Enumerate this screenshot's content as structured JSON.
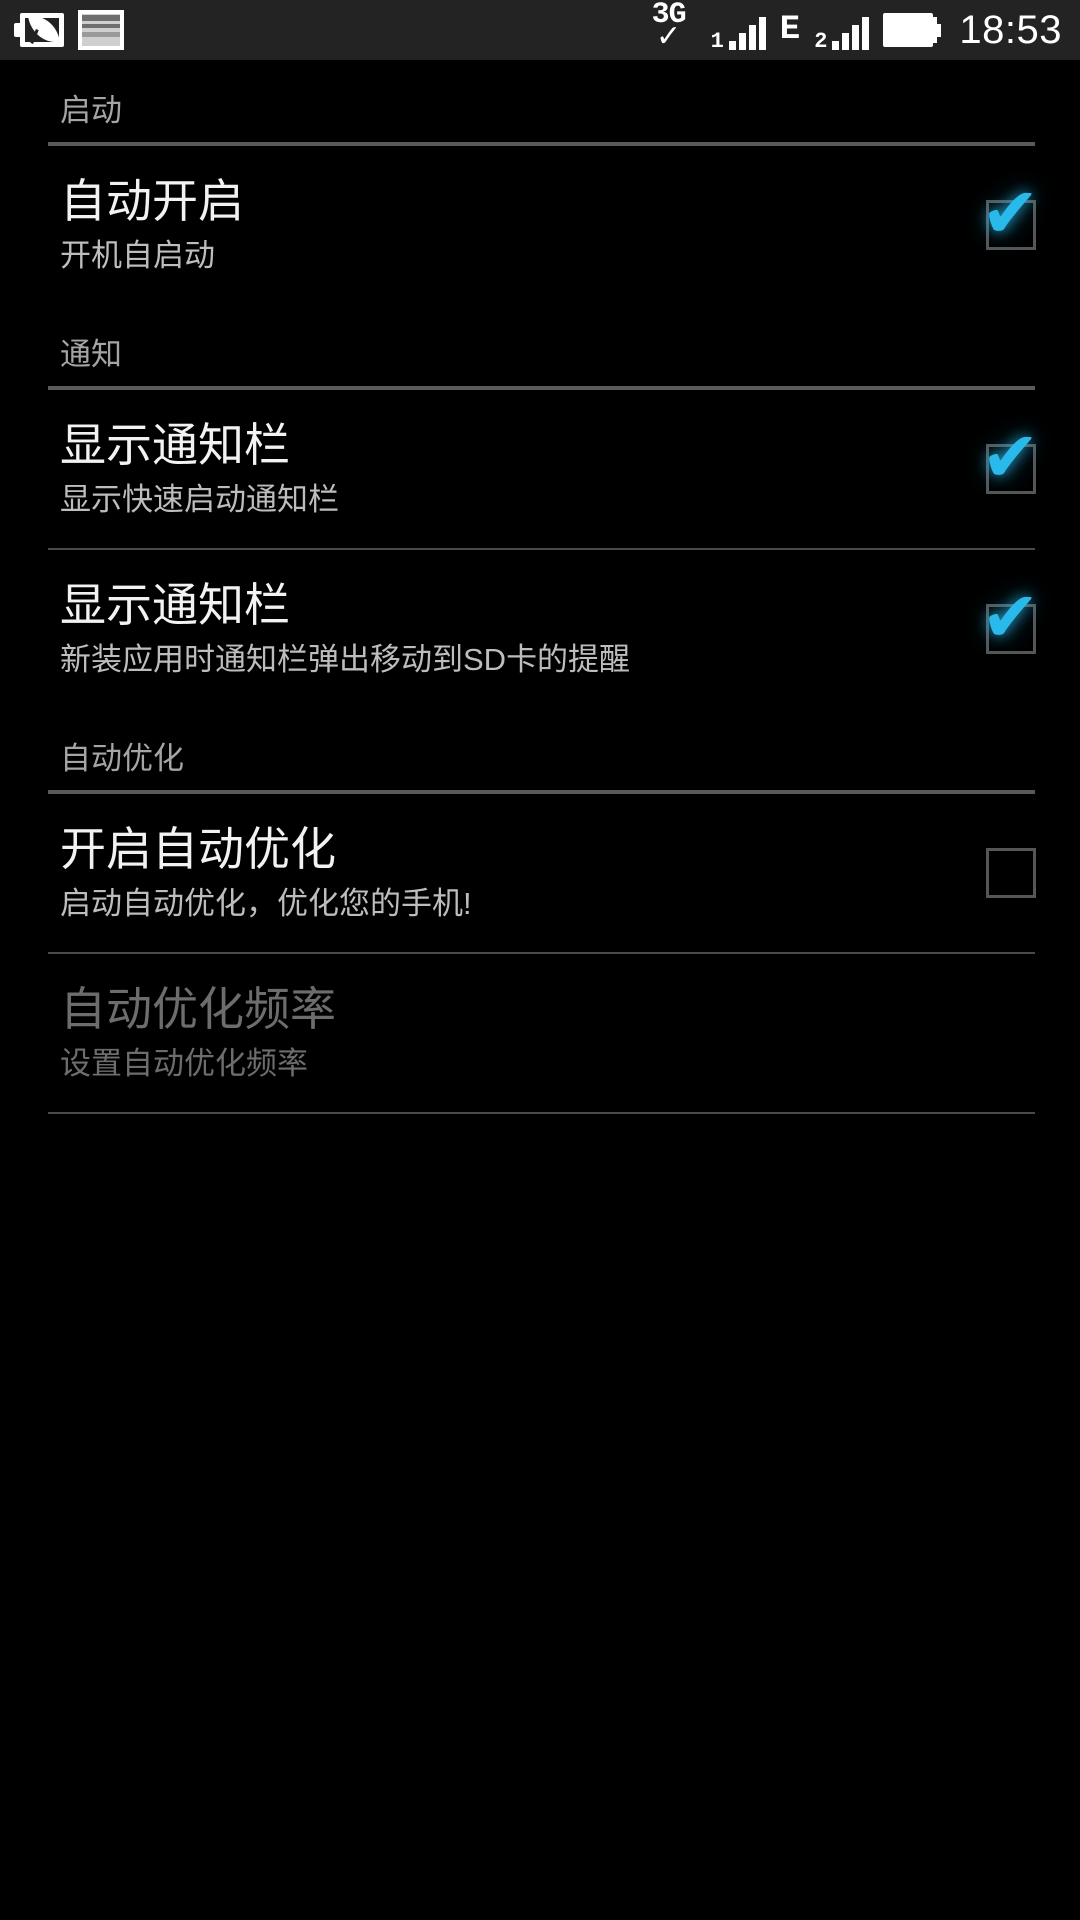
{
  "statusbar": {
    "icons": [
      {
        "name": "power-saver-leaf-battery-icon"
      },
      {
        "name": "screenshot-picture-icon"
      },
      {
        "name": "network-3g-check-icon",
        "label": "3G",
        "check": "✓"
      },
      {
        "name": "signal-bars-sim1-icon",
        "sim": "1"
      },
      {
        "name": "network-edge-icon",
        "label": "E"
      },
      {
        "name": "signal-bars-sim2-icon",
        "sim": "2"
      },
      {
        "name": "battery-full-icon"
      }
    ],
    "network_3g_label": "3G",
    "network_3g_check": "✓",
    "sim1_label": "1",
    "edge_label": "E",
    "sim2_label": "2",
    "clock": "18:53"
  },
  "colors": {
    "background": "#000000",
    "statusbar_bg": "#232323",
    "accent_check": "#29b9ea",
    "section_header_text": "#a5a5a5",
    "title_text": "#f2f2f2",
    "subtitle_text": "#bdbdbd",
    "disabled_text": "#6d6d6d",
    "divider_thick": "#5a5a5a",
    "divider_thin": "#4a4a4a",
    "checkbox_border": "#565656"
  },
  "sections": [
    {
      "header": "启动",
      "items": [
        {
          "title": "自动开启",
          "subtitle": "开机自启动",
          "checked": true,
          "enabled": true,
          "check_glyph": "✔"
        }
      ]
    },
    {
      "header": "通知",
      "items": [
        {
          "title": "显示通知栏",
          "subtitle": "显示快速启动通知栏",
          "checked": true,
          "enabled": true,
          "check_glyph": "✔"
        },
        {
          "title": "显示通知栏",
          "subtitle": "新装应用时通知栏弹出移动到SD卡的提醒",
          "checked": true,
          "enabled": true,
          "check_glyph": "✔"
        }
      ]
    },
    {
      "header": "自动优化",
      "items": [
        {
          "title": "开启自动优化",
          "subtitle": "启动自动优化，优化您的手机!",
          "checked": false,
          "enabled": true,
          "check_glyph": "✔"
        },
        {
          "title": "自动优化频率",
          "subtitle": "设置自动优化频率",
          "checked": false,
          "enabled": false,
          "has_checkbox": false,
          "check_glyph": "✔"
        }
      ]
    }
  ]
}
